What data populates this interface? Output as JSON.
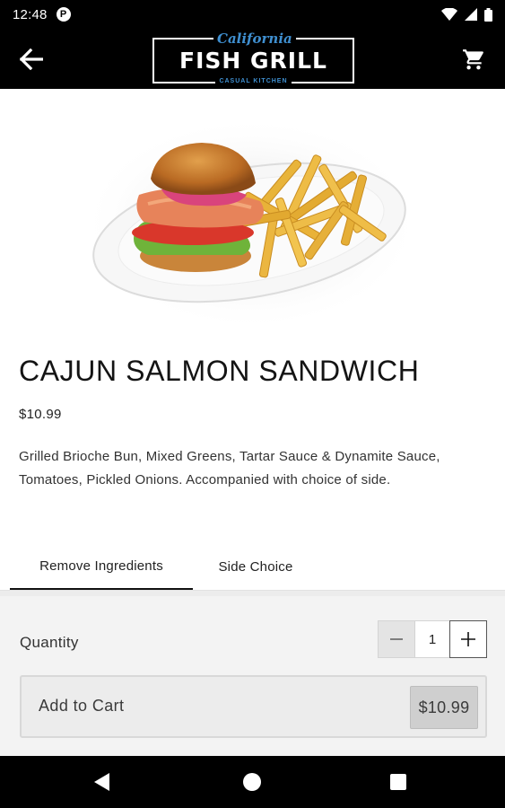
{
  "status_bar": {
    "time": "12:48",
    "app_icon_glyph": "P",
    "icons": [
      "wifi-icon",
      "cell-signal-icon",
      "battery-icon"
    ]
  },
  "app_bar": {
    "logo": {
      "script": "California",
      "main": "FISH GRILL",
      "sub": "CASUAL KITCHEN"
    },
    "back_icon": "arrow-left-icon",
    "cart_icon": "shopping-cart-icon"
  },
  "product": {
    "title": "CAJUN SALMON SANDWICH",
    "price": "$10.99",
    "description": "Grilled Brioche Bun, Mixed Greens, Tartar Sauce & Dynamite Sauce, Tomatoes, Pickled Onions. Accompanied with choice of side."
  },
  "tabs": {
    "remove": "Remove Ingredients",
    "side": "Side Choice"
  },
  "order": {
    "quantity_label": "Quantity",
    "quantity": "1",
    "add_to_cart_label": "Add to Cart",
    "add_to_cart_price": "$10.99"
  },
  "colors": {
    "bar_bg": "#000000",
    "logo_blue": "#3f8fd0",
    "panel_bg": "#f3f3f3"
  }
}
